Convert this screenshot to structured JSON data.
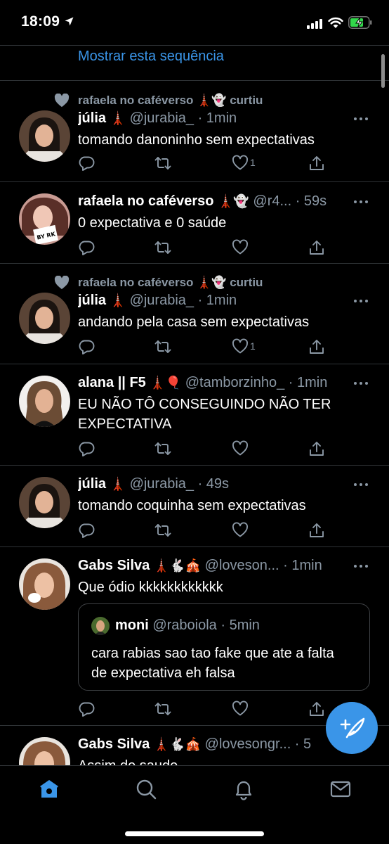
{
  "status": {
    "time": "18:09"
  },
  "feed": {
    "show_thread": "Mostrar esta sequência",
    "tweets": [
      {
        "liked_by": "rafaela no caféverso 🗼👻 curtiu",
        "name": "júlia",
        "name_emoji": "🗼",
        "handle": "@jurabia_ · 1min",
        "text": "tomando danoninho sem expectativas",
        "like_count": "1"
      },
      {
        "name": "rafaela no caféverso",
        "name_emoji": "🗼👻",
        "handle": "@r4... · 59s",
        "text": "0 expectativa e 0 saúde",
        "like_count": ""
      },
      {
        "liked_by": "rafaela no caféverso 🗼👻 curtiu",
        "name": "júlia",
        "name_emoji": "🗼",
        "handle": "@jurabia_ · 1min",
        "text": "andando pela casa sem expectativas",
        "like_count": "1"
      },
      {
        "name": "alana || F5",
        "name_emoji": "🗼🎈",
        "handle": "@tamborzinho_ · 1min",
        "text_line1": "EU NÃO TÔ CONSEGUINDO NÃO TER",
        "text_line2": "EXPECTATIVA",
        "like_count": ""
      },
      {
        "name": "júlia",
        "name_emoji": "🗼",
        "handle": "@jurabia_ · 49s",
        "text": "tomando coquinha sem expectativas",
        "like_count": ""
      },
      {
        "name": "Gabs Silva",
        "name_emoji": "🗼🐇🎪",
        "handle": "@loveson... · 1min",
        "text": "Que ódio kkkkkkkkkkkk",
        "quote": {
          "name": "moni",
          "handle": "@raboiola · 5min",
          "text_line1": "cara rabias sao tao fake que ate a falta",
          "text_line2": "de expectativa eh falsa"
        },
        "like_count": ""
      },
      {
        "name": "Gabs Silva",
        "name_emoji": "🗼🐇🎪",
        "handle": "@lovesongr... · 5",
        "text": "Assim de saude"
      }
    ]
  },
  "colors": {
    "accent": "#3a95e8",
    "muted": "#8b98a5",
    "divider": "#2f3336",
    "background": "#000000"
  },
  "icons": [
    "location-arrow-icon",
    "signal-icon",
    "wifi-icon",
    "battery-icon",
    "heart-icon",
    "reply-icon",
    "retweet-icon",
    "share-icon",
    "more-icon",
    "compose-icon",
    "home-icon",
    "search-icon",
    "notifications-icon",
    "messages-icon"
  ]
}
